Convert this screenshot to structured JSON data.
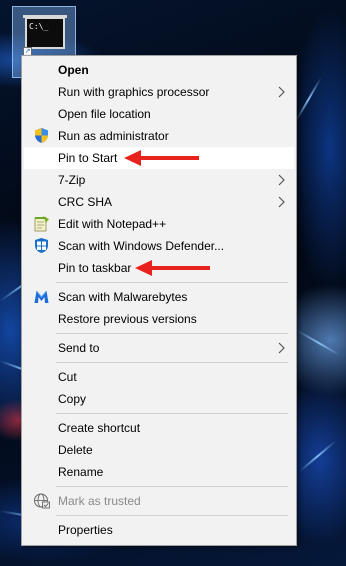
{
  "desktop": {
    "icon_name": "terminal-icon",
    "cmd_text": "C:\\_"
  },
  "menu": {
    "items": [
      {
        "id": "open",
        "label": "Open",
        "bold": true
      },
      {
        "id": "run-gpu",
        "label": "Run with graphics processor",
        "submenu": true
      },
      {
        "id": "open-file-location",
        "label": "Open file location"
      },
      {
        "id": "run-as-admin",
        "label": "Run as administrator",
        "icon": "uac-shield-icon"
      },
      {
        "id": "pin-to-start",
        "label": "Pin to Start",
        "highlighted": true
      },
      {
        "id": "7zip",
        "label": "7-Zip",
        "submenu": true
      },
      {
        "id": "crc-sha",
        "label": "CRC SHA",
        "submenu": true
      },
      {
        "id": "edit-notepad",
        "label": "Edit with Notepad++",
        "icon": "notepad-plus-plus-icon"
      },
      {
        "id": "scan-defender",
        "label": "Scan with Windows Defender...",
        "icon": "windows-defender-icon"
      },
      {
        "id": "pin-taskbar",
        "label": "Pin to taskbar"
      },
      {
        "id": "scan-malwarebytes",
        "label": "Scan with Malwarebytes",
        "icon": "malwarebytes-icon"
      },
      {
        "id": "restore-previous",
        "label": "Restore previous versions"
      },
      {
        "id": "send-to",
        "label": "Send to",
        "submenu": true
      },
      {
        "id": "cut",
        "label": "Cut"
      },
      {
        "id": "copy",
        "label": "Copy"
      },
      {
        "id": "create-shortcut",
        "label": "Create shortcut"
      },
      {
        "id": "delete",
        "label": "Delete"
      },
      {
        "id": "rename",
        "label": "Rename"
      },
      {
        "id": "mark-trusted",
        "label": "Mark as trusted",
        "icon": "trusted-globe-icon",
        "disabled": true
      },
      {
        "id": "properties",
        "label": "Properties"
      }
    ]
  },
  "annotations": {
    "arrow_color": "#e8231e",
    "arrow_targets": [
      "Pin to Start",
      "Pin to taskbar"
    ]
  },
  "colors": {
    "menu_bg": "#f2f2f2",
    "menu_highlight": "#ffffff",
    "disabled_text": "#8a8a8a"
  }
}
